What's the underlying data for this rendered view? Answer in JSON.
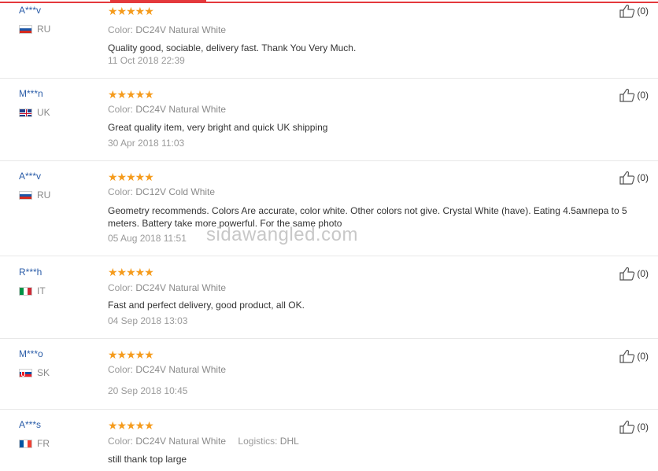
{
  "colors": {
    "accent": "#e4393c",
    "stars": "#f59b1c",
    "username": "#2b5da8"
  },
  "labels": {
    "color_key": "Color:",
    "logistics_key": "Logistics:"
  },
  "reviews": [
    {
      "user": "A***v",
      "country": "RU",
      "stars": "★★★★★",
      "color": "DC24V Natural White",
      "text": "Quality good, sociable, delivery fast. Thank You Very Much.",
      "date": "11 Oct 2018 22:39",
      "likes": "(0)"
    },
    {
      "user": "M***n",
      "country": "UK",
      "stars": "★★★★★",
      "color": "DC24V Natural White",
      "text": "Great quality item, very bright and quick UK shipping",
      "date": "30 Apr 2018 11:03",
      "likes": "(0)"
    },
    {
      "user": "A***v",
      "country": "RU",
      "stars": "★★★★★",
      "color": "DC12V Cold White",
      "text": "Geometry recommends. Colors Are accurate, color white. Other colors not give. Crystal White (have). Eating 4.5ампера to 5 meters. Battery take more powerful. For the same photo",
      "date": "05 Aug 2018 11:51",
      "likes": "(0)"
    },
    {
      "user": "R***h",
      "country": "IT",
      "stars": "★★★★★",
      "color": "DC24V Natural White",
      "text": "Fast and perfect delivery, good product, all OK.",
      "date": "04 Sep 2018 13:03",
      "likes": "(0)"
    },
    {
      "user": "M***o",
      "country": "SK",
      "stars": "★★★★★",
      "color": "DC24V Natural White",
      "text": "",
      "date": "20 Sep 2018 10:45",
      "likes": "(0)"
    },
    {
      "user": "A***s",
      "country": "FR",
      "stars": "★★★★★",
      "color": "DC24V Natural White",
      "logistics": "DHL",
      "text": "still thank top large",
      "date": "",
      "likes": "(0)"
    }
  ],
  "watermark": "sidawangled.com"
}
